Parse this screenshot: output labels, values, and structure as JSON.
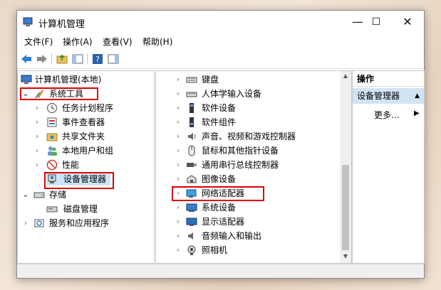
{
  "window": {
    "title": "计算机管理"
  },
  "menu": [
    "文件(F)",
    "操作(A)",
    "查看(V)",
    "帮助(H)"
  ],
  "tree": {
    "root": "计算机管理(本地)",
    "system_tools": "系统工具",
    "items": [
      "任务计划程序",
      "事件查看器",
      "共享文件夹",
      "本地用户和组",
      "性能",
      "设备管理器"
    ],
    "storage": "存储",
    "disk": "磁盘管理",
    "services": "服务和应用程序"
  },
  "devices": [
    "键盘",
    "人体学输入设备",
    "软件设备",
    "软件组件",
    "声音、视频和游戏控制器",
    "鼠标和其他指针设备",
    "通用串行总线控制器",
    "图像设备",
    "网络适配器",
    "系统设备",
    "显示适配器",
    "音频输入和输出",
    "照相机"
  ],
  "actions": {
    "header": "操作",
    "selected": "设备管理器",
    "more": "更多..."
  },
  "colors": {
    "highlight": "#e00000",
    "selection": "#cce4f7"
  }
}
